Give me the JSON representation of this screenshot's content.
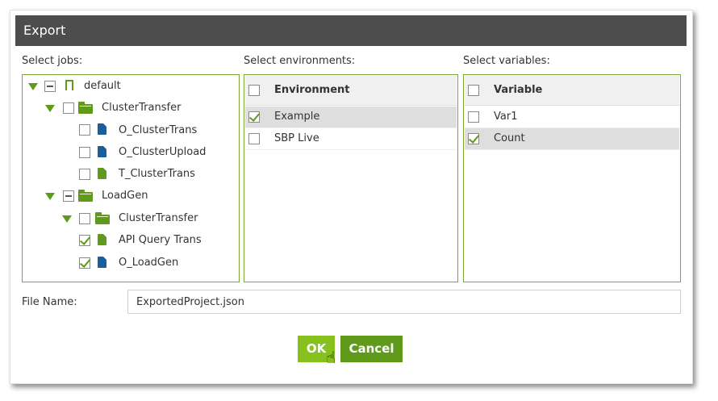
{
  "dialog": {
    "title": "Export",
    "sections": {
      "jobs_label": "Select jobs:",
      "envs_label": "Select environments:",
      "vars_label": "Select variables:"
    },
    "jobs_tree": {
      "root": "default",
      "cluster_transfer": "ClusterTransfer",
      "o_clustertrans": "O_ClusterTrans",
      "o_clusterupload": "O_ClusterUpload",
      "t_clustertrans": "T_ClusterTrans",
      "loadgen": "LoadGen",
      "loadgen_cluster_transfer": "ClusterTransfer",
      "api_query_trans": "API Query Trans",
      "o_loadgen": "O_LoadGen"
    },
    "environments": {
      "header": "Environment",
      "rows": [
        "Example",
        "SBP Live"
      ]
    },
    "variables": {
      "header": "Variable",
      "rows": [
        "Var1",
        "Count"
      ]
    },
    "file_name": {
      "label": "File Name:",
      "value": "ExportedProject.json"
    },
    "buttons": {
      "ok": "OK",
      "cancel": "Cancel"
    },
    "colors": {
      "accent_green": "#5f9a1a",
      "ok_green": "#86c11d",
      "title_bar": "#4d4d4d"
    }
  }
}
